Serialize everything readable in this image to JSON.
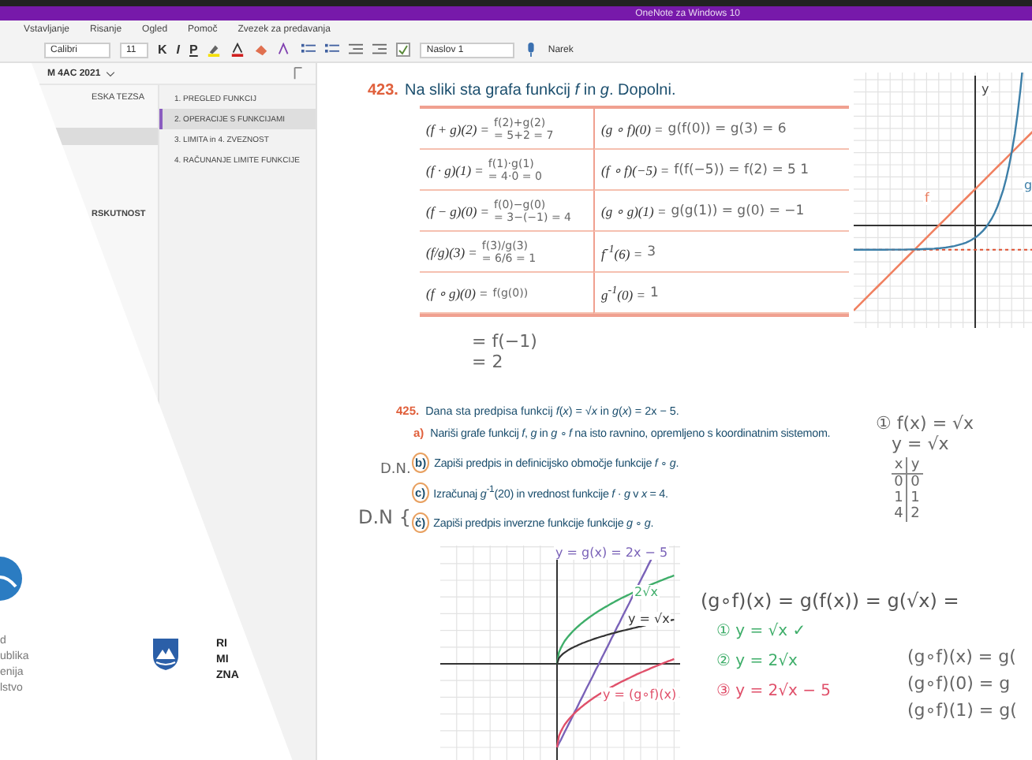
{
  "window": {
    "title": "OneNote za Windows 10"
  },
  "menu": [
    "Vstavljanje",
    "Risanje",
    "Ogled",
    "Pomoč",
    "Zvezek za predavanja"
  ],
  "toolbar": {
    "font": "Calibri",
    "size": "11",
    "bold": "K",
    "italic": "I",
    "underline": "P",
    "style": "Naslov 1",
    "dictate": "Narek",
    "todo_checked": true
  },
  "notebook": {
    "name": "M 4AC 2021"
  },
  "sections": [
    {
      "label": "ESKA TEZSA",
      "selected": false
    },
    {
      "selected": true
    },
    {
      "label": "RSKUTNOST",
      "selected": false
    }
  ],
  "pages": [
    {
      "label": "1. PREGLED FUNKCIJ",
      "selected": false
    },
    {
      "label": "2. OPERACIJE S FUNKCIJAMI",
      "selected": true
    },
    {
      "label": "3. LIMITA in 4. ZVEZNOST",
      "selected": false
    },
    {
      "label": "4. RAČUNANJE LIMITE FUNKCIJE",
      "selected": false
    }
  ],
  "overlay": {
    "lines_left": [
      "d",
      "ublika",
      "enija",
      "lstvo"
    ],
    "lines_right": [
      "RI",
      "MI",
      "ZNA"
    ]
  },
  "problem_423": {
    "number": "423.",
    "text": "Na sliki sta grafa funkcij *f* in *g*. Dopolni.",
    "rows": [
      [
        {
          "printed": "(f + g)(2) =",
          "handwritten": [
            "f(2)+g(2)",
            "= 5+2 = 7"
          ]
        },
        {
          "printed": "(g ∘ f)(0) =",
          "handwritten": [
            "g(f(0)) = g(3) = 6"
          ]
        }
      ],
      [
        {
          "printed": "(f · g)(1) =",
          "handwritten": [
            "f(1)·g(1)",
            "= 4·0 = 0"
          ]
        },
        {
          "printed": "(f ∘ f)(−5) =",
          "handwritten": [
            "f(f(−5)) = f(2) = 5 1"
          ]
        }
      ],
      [
        {
          "printed": "(f − g)(0) =",
          "handwritten": [
            "f(0)−g(0)",
            "= 3−(−1) = 4"
          ]
        },
        {
          "printed": "(g ∘ g)(1) =",
          "handwritten": [
            "g(g(1)) = g(0) = −1"
          ]
        }
      ],
      [
        {
          "printed": "(f/g)(3) =",
          "handwritten": [
            "f(3)/g(3)",
            "= 6/6 = 1"
          ]
        },
        {
          "printed": "f$^{-1}$(6) =",
          "handwritten": [
            "3"
          ]
        }
      ],
      [
        {
          "printed": "(f ∘ g)(0) =",
          "handwritten": [
            "f(g(0))"
          ]
        },
        {
          "printed": "g$^{-1}$(0) =",
          "handwritten": [
            "1"
          ]
        }
      ]
    ],
    "work": [
      "= f(−1)",
      "= 2"
    ]
  },
  "graph_1": {
    "labels": [
      {
        "text": "y",
        "color": "#444444"
      },
      {
        "text": "f",
        "color": "#e8795a"
      },
      {
        "text": "g",
        "color": "#3d7fa8"
      }
    ]
  },
  "problem_425": {
    "number": "425.",
    "text": "Dana sta predpisa funkcij *f*(*x*) = √*x* in *g*(*x*) = 2x − 5.",
    "items": [
      {
        "letter": "a)",
        "circled": false,
        "text": "Nariši grafe funkcij *f*, *g* in *g* ∘ *f* na isto ravnino, opremljeno s koordinatnim sistemom."
      },
      {
        "letter": "b)",
        "circled": true,
        "text": "Zapiši predpis in definicijsko območje funkcije *f* ∘ *g*."
      },
      {
        "letter": "c)",
        "circled": true,
        "text": "Izračunaj *g*$^{-1}$(20) in vrednost funkcije *f* · *g* v *x* = 4."
      },
      {
        "letter": "č)",
        "circled": true,
        "text": "Zapiši predpis inverzne funkcije funkcije *g* ∘ *g*."
      }
    ]
  },
  "margin_notes": [
    "D.N.",
    "D.N {"
  ],
  "graph_2": {
    "labels": [
      {
        "text": "y = g(x) = 2x − 5",
        "color": "#7a62b8"
      },
      {
        "text": "2√x",
        "color": "#3fae6a"
      },
      {
        "text": "y = √x",
        "color": "#333333"
      },
      {
        "text": "y = (g∘f)(x)",
        "color": "#e0506a"
      }
    ]
  },
  "value_notes": {
    "lines": [
      "① f(x) = √x",
      "y = √x"
    ],
    "table": {
      "header": [
        "x",
        "y"
      ],
      "rows": [
        [
          "0",
          "0"
        ],
        [
          "1",
          "1"
        ],
        [
          "4",
          "2"
        ]
      ]
    }
  },
  "composition_notes": [
    {
      "text": "(g∘f)(x) = g(f(x)) = g(√x) =",
      "color": "#555555"
    },
    {
      "text": "① y = √x ✓",
      "color": "#3fae6a"
    },
    {
      "text": "② y = 2√x",
      "color": "#3fae6a"
    },
    {
      "text": "③ y = 2√x − 5",
      "color": "#e0506a"
    }
  ],
  "side_notes": [
    "(g∘f)(x) = g(",
    "(g∘f)(0) = g",
    "(g∘f)(1) = g("
  ]
}
